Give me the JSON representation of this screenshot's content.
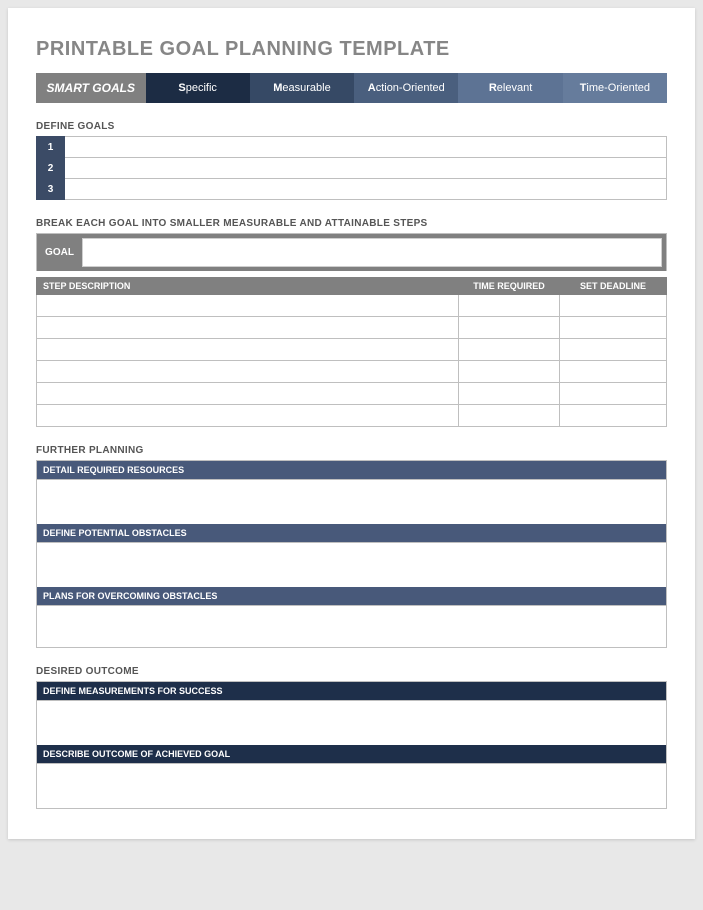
{
  "title": "PRINTABLE GOAL PLANNING TEMPLATE",
  "smart": {
    "label": "SMART GOALS",
    "items": [
      {
        "cap": "S",
        "rest": "pecific"
      },
      {
        "cap": "M",
        "rest": "easurable"
      },
      {
        "cap": "A",
        "rest": "ction-Oriented"
      },
      {
        "cap": "R",
        "rest": "elevant"
      },
      {
        "cap": "T",
        "rest": "ime-Oriented"
      }
    ]
  },
  "defineGoals": {
    "label": "DEFINE GOALS",
    "rows": [
      "1",
      "2",
      "3"
    ]
  },
  "breakSteps": {
    "label": "BREAK EACH GOAL INTO SMALLER MEASURABLE AND ATTAINABLE STEPS",
    "goalLabel": "GOAL",
    "cols": [
      "STEP DESCRIPTION",
      "TIME REQUIRED",
      "SET DEADLINE"
    ],
    "rowCount": 6
  },
  "furtherPlanning": {
    "label": "FURTHER PLANNING",
    "sections": [
      "DETAIL REQUIRED RESOURCES",
      "DEFINE POTENTIAL OBSTACLES",
      "PLANS FOR OVERCOMING OBSTACLES"
    ]
  },
  "desiredOutcome": {
    "label": "DESIRED OUTCOME",
    "sections": [
      "DEFINE MEASUREMENTS FOR SUCCESS",
      "DESCRIBE OUTCOME OF ACHIEVED GOAL"
    ]
  }
}
